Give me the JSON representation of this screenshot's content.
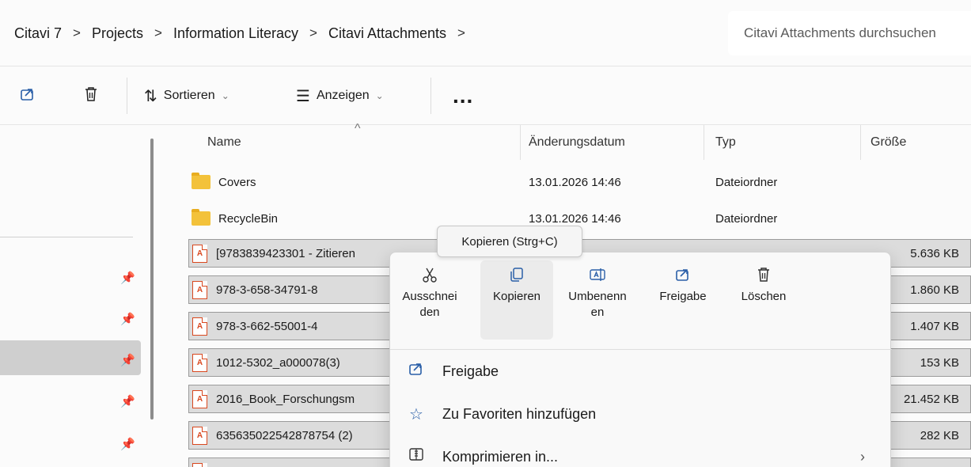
{
  "breadcrumb": {
    "items": [
      "Citavi 7",
      "Projects",
      "Information Literacy",
      "Citavi Attachments"
    ],
    "separator": ">"
  },
  "search": {
    "placeholder": "Citavi Attachments durchsuchen"
  },
  "toolbar": {
    "sort_label": "Sortieren",
    "view_label": "Anzeigen",
    "more_label": "..."
  },
  "columns": {
    "name": "Name",
    "date": "Änderungsdatum",
    "type": "Typ",
    "size": "Größe"
  },
  "files": [
    {
      "name": "Covers",
      "date": "13.01.2026 14:46",
      "type": "Dateiordner",
      "size": "",
      "kind": "folder"
    },
    {
      "name": "RecycleBin",
      "date": "13.01.2026 14:46",
      "type": "Dateiordner",
      "size": "",
      "kind": "folder"
    },
    {
      "name": "[9783839423301 - Zitieren",
      "date": "",
      "type": "",
      "size": "5.636 KB",
      "kind": "pdf"
    },
    {
      "name": "978-3-658-34791-8",
      "date": "",
      "type": "",
      "size": "1.860 KB",
      "kind": "pdf"
    },
    {
      "name": "978-3-662-55001-4",
      "date": "",
      "type": "",
      "size": "1.407 KB",
      "kind": "pdf"
    },
    {
      "name": "1012-5302_a000078(3)",
      "date": "",
      "type": "",
      "size": "153 KB",
      "kind": "pdf"
    },
    {
      "name": "2016_Book_Forschungsm",
      "date": "",
      "type": "",
      "size": "21.452 KB",
      "kind": "pdf"
    },
    {
      "name": "635635022542878754 (2)",
      "date": "",
      "type": "",
      "size": "282 KB",
      "kind": "pdf"
    }
  ],
  "tooltip": {
    "text": "Kopieren (Strg+C)"
  },
  "context_menu": {
    "quick_actions": [
      {
        "label_line1": "Ausschnei",
        "label_line2": "den",
        "icon": "cut-icon"
      },
      {
        "label_line1": "Kopieren",
        "label_line2": "",
        "icon": "copy-icon"
      },
      {
        "label_line1": "Umbenenn",
        "label_line2": "en",
        "icon": "rename-icon"
      },
      {
        "label_line1": "Freigabe",
        "label_line2": "",
        "icon": "share-icon"
      },
      {
        "label_line1": "Löschen",
        "label_line2": "",
        "icon": "trash-icon"
      }
    ],
    "items": [
      {
        "label": "Freigabe",
        "icon": "share-icon"
      },
      {
        "label": "Zu Favoriten hinzufügen",
        "icon": "star-icon"
      },
      {
        "label": "Komprimieren in...",
        "icon": "zip-icon"
      }
    ]
  },
  "colors": {
    "accent": "#2a5fa8",
    "folder": "#f3c23a",
    "pdf": "#d9481f",
    "selected_row": "#dcdcdc"
  }
}
